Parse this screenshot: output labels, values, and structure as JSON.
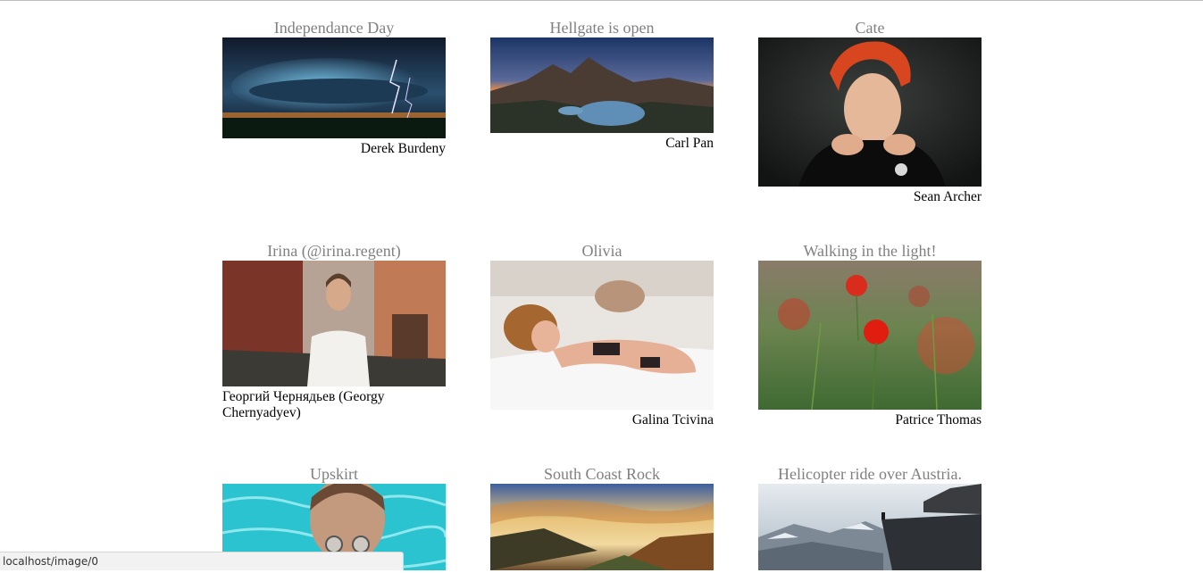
{
  "gallery": [
    {
      "title": "Independance Day",
      "author": "Derek Burdeny",
      "image": "storm-landscape"
    },
    {
      "title": "Hellgate is open",
      "author": "Carl Pan",
      "image": "mountain-lake-panorama"
    },
    {
      "title": "Cate",
      "author": "Sean Archer",
      "image": "red-haired-woman-portrait"
    },
    {
      "title": "Irina (@irina.regent)",
      "author": "Георгий Чернядьев (Georgy Chernyadyev)",
      "image": "woman-in-street"
    },
    {
      "title": "Olivia",
      "author": "Galina Tcivina",
      "image": "woman-on-bed"
    },
    {
      "title": "Walking in the light!",
      "author": "Patrice Thomas",
      "image": "red-poppy-field"
    },
    {
      "title": "Upskirt",
      "author": "",
      "image": "woman-in-pool"
    },
    {
      "title": "South Coast Rock",
      "author": "",
      "image": "sunset-hills"
    },
    {
      "title": "Helicopter ride over Austria.",
      "author": "",
      "image": "cliff-over-mountains"
    }
  ],
  "status_bar": {
    "url": "localhost/image/0"
  }
}
